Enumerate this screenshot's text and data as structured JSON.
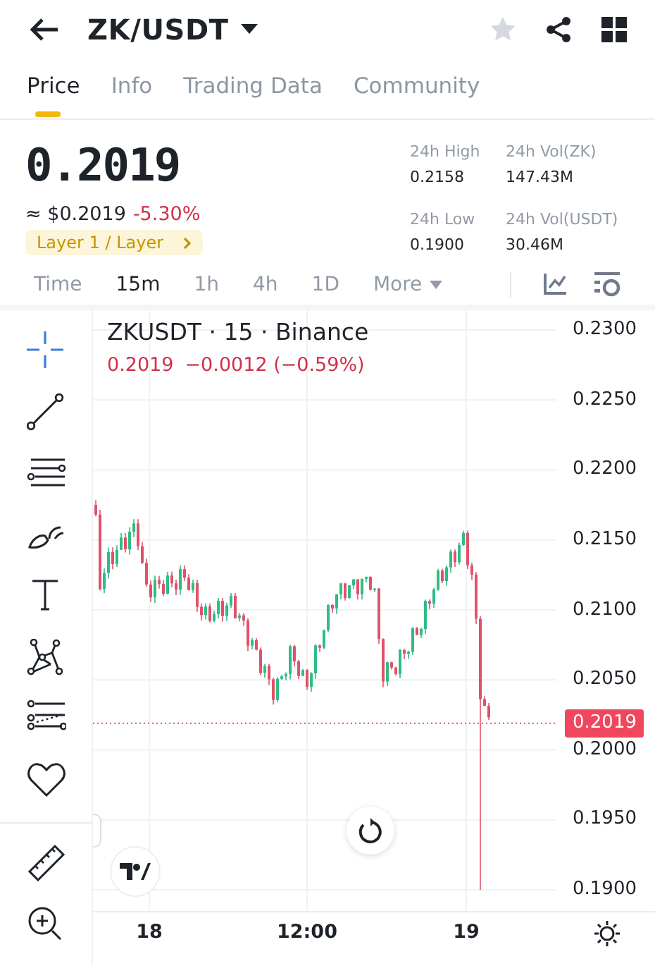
{
  "header": {
    "pair": "ZK/USDT",
    "favorite": false
  },
  "tabs": [
    {
      "label": "Price",
      "selected": true
    },
    {
      "label": "Info",
      "selected": false
    },
    {
      "label": "Trading Data",
      "selected": false
    },
    {
      "label": "Community",
      "selected": false
    }
  ],
  "ticker": {
    "last": "0.2019",
    "usd": "≈ $0.2019",
    "change": "-5.30%",
    "tag": "Layer 1 / Layer"
  },
  "stats": [
    {
      "label": "24h High",
      "value": "0.2158"
    },
    {
      "label": "24h Vol(ZK)",
      "value": "147.43M"
    },
    {
      "label": "24h Low",
      "value": "0.1900"
    },
    {
      "label": "24h Vol(USDT)",
      "value": "30.46M"
    }
  ],
  "intervals": [
    {
      "label": "Time",
      "selected": false,
      "kind": "plain"
    },
    {
      "label": "15m",
      "selected": true,
      "kind": "plain"
    },
    {
      "label": "1h",
      "selected": false,
      "kind": "plain"
    },
    {
      "label": "4h",
      "selected": false,
      "kind": "plain"
    },
    {
      "label": "1D",
      "selected": false,
      "kind": "plain"
    },
    {
      "label": "More",
      "selected": false,
      "kind": "dropdown"
    }
  ],
  "tools": [
    {
      "kind": "crosshair",
      "selected": true
    },
    {
      "kind": "trendline",
      "selected": false
    },
    {
      "kind": "lines",
      "selected": false
    },
    {
      "kind": "brush",
      "selected": false
    },
    {
      "kind": "text",
      "selected": false
    },
    {
      "kind": "pattern",
      "selected": false
    },
    {
      "kind": "fib",
      "selected": false
    },
    {
      "kind": "favorite",
      "selected": false
    },
    {
      "kind": "ruler",
      "selected": false
    },
    {
      "kind": "zoom",
      "selected": false
    }
  ],
  "chart": {
    "title": "ZKUSDT · 15 · Binance",
    "quote_price": "0.2019",
    "quote_change": "−0.0012 (−0.59%)",
    "price_tag": "0.2019",
    "y_labels": [
      "0.2300",
      "0.2250",
      "0.2200",
      "0.2150",
      "0.2100",
      "0.2050",
      "0.2000",
      "0.1950",
      "0.1900"
    ],
    "x_labels": [
      "18",
      "12:00",
      "19"
    ]
  }
}
